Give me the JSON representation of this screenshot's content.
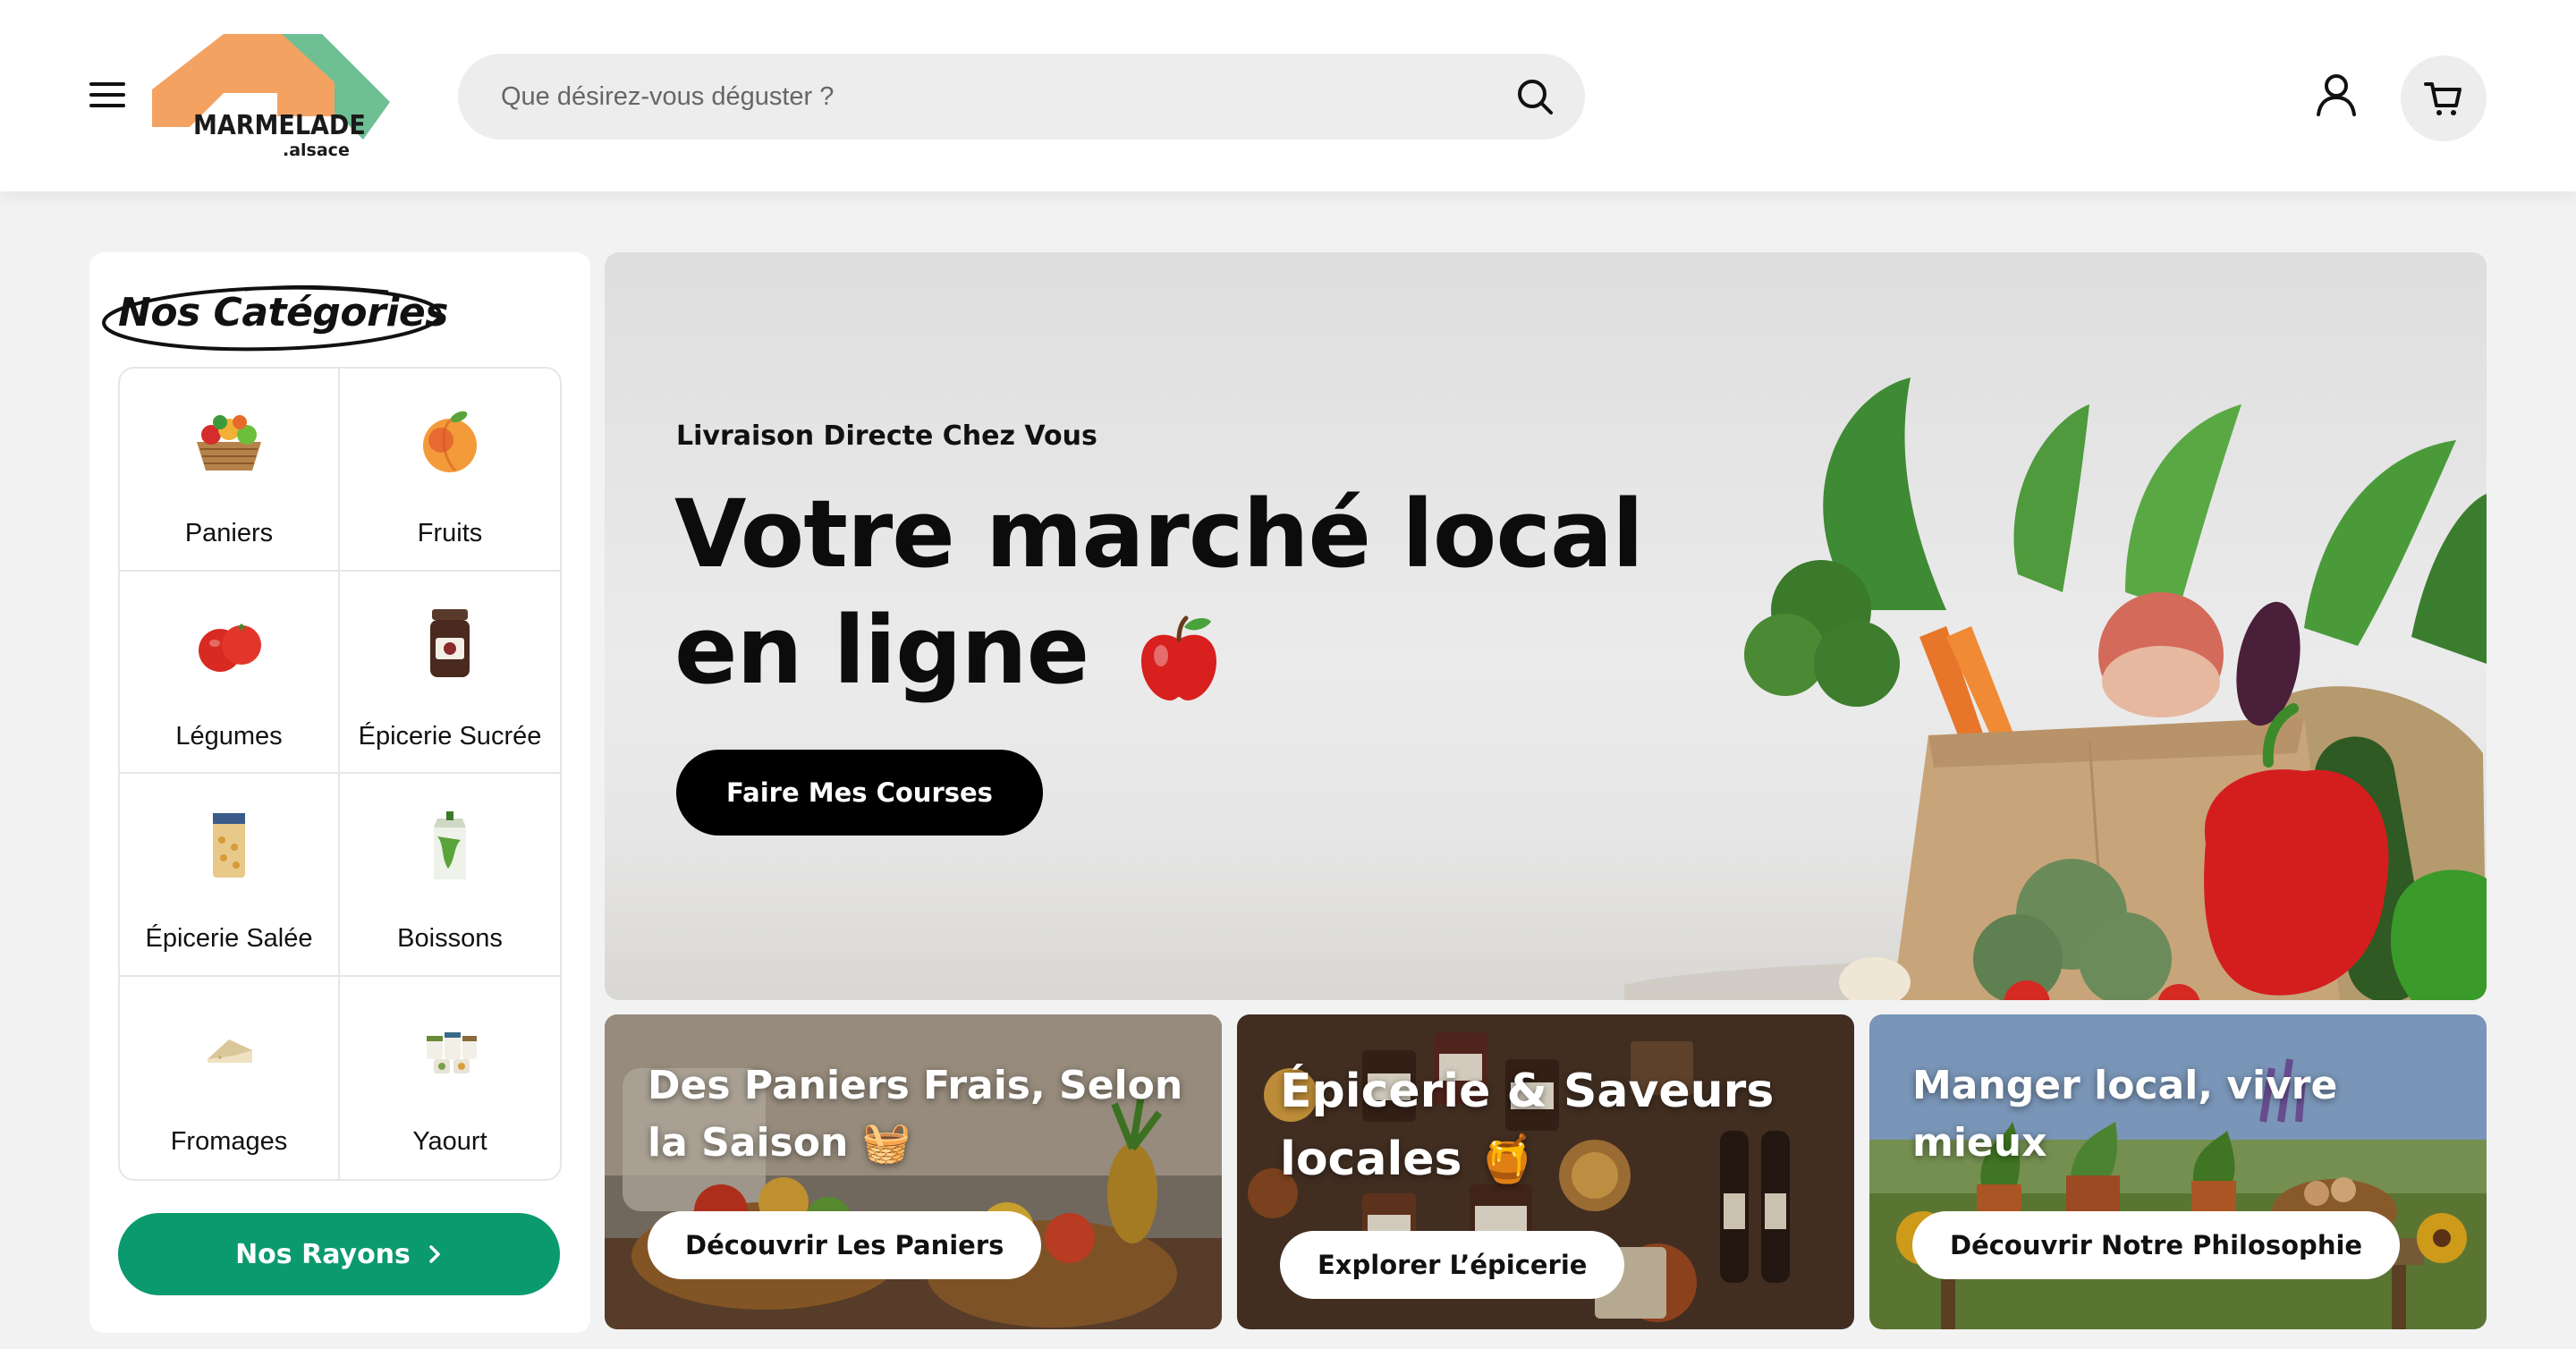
{
  "header": {
    "menu_icon": "hamburger-menu-icon",
    "logo": {
      "brand": "MARMELADE",
      "suffix": ".alsace"
    },
    "search": {
      "placeholder": "Que désirez-vous déguster ?",
      "value": ""
    },
    "icons": {
      "search": "search-icon",
      "account": "user-icon",
      "cart": "cart-icon"
    }
  },
  "sidebar": {
    "title": "Nos Catégories",
    "categories": [
      {
        "label": "Paniers",
        "icon": "basket-icon"
      },
      {
        "label": "Fruits",
        "icon": "peach-icon"
      },
      {
        "label": "Légumes",
        "icon": "tomato-icon"
      },
      {
        "label": "Épicerie Sucrée",
        "icon": "jam-jar-icon"
      },
      {
        "label": "Épicerie Salée",
        "icon": "pasta-bag-icon"
      },
      {
        "label": "Boissons",
        "icon": "juice-carton-icon"
      },
      {
        "label": "Fromages",
        "icon": "cheese-icon"
      },
      {
        "label": "Yaourt",
        "icon": "yogurt-pots-icon"
      }
    ],
    "cta_label": "Nos Rayons"
  },
  "hero": {
    "kicker": "Livraison Directe Chez Vous",
    "title_line1": "Votre marché local",
    "title_line2": "en ligne",
    "title_emoji": "apple-icon",
    "cta_label": "Faire Mes Courses"
  },
  "promo_cards": [
    {
      "title": "Des Paniers Frais, Selon la Saison 🧺",
      "cta": "Découvrir Les Paniers"
    },
    {
      "title": "Épicerie & Saveurs locales 🍯",
      "cta": "Explorer L’épicerie"
    },
    {
      "title": "Manger local, vivre mieux",
      "cta": "Découvrir Notre Philosophie"
    }
  ],
  "colors": {
    "accent_green": "#0b9a6e",
    "logo_orange": "#f4a261",
    "logo_green": "#6fbf95",
    "hero_button": "#000000"
  }
}
